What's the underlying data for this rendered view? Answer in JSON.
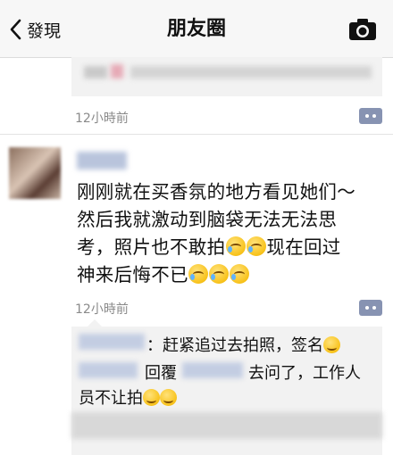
{
  "nav": {
    "back_label": "發現",
    "title": "朋友圈"
  },
  "post1": {
    "time": "12小時前"
  },
  "post2": {
    "lines": [
      "刚刚就在买香氛的地方看见她们～",
      "然后我就激动到脑袋无法无法思",
      "考，照片也不敢拍",
      "现在回过",
      "神来后悔不已"
    ],
    "time": "12小時前",
    "comments": [
      {
        "text": "：赶紧追过去拍照，签名"
      },
      {
        "reply_label": "回覆",
        "text": "去问了，工作人"
      },
      {
        "text": "员不让拍"
      }
    ]
  }
}
